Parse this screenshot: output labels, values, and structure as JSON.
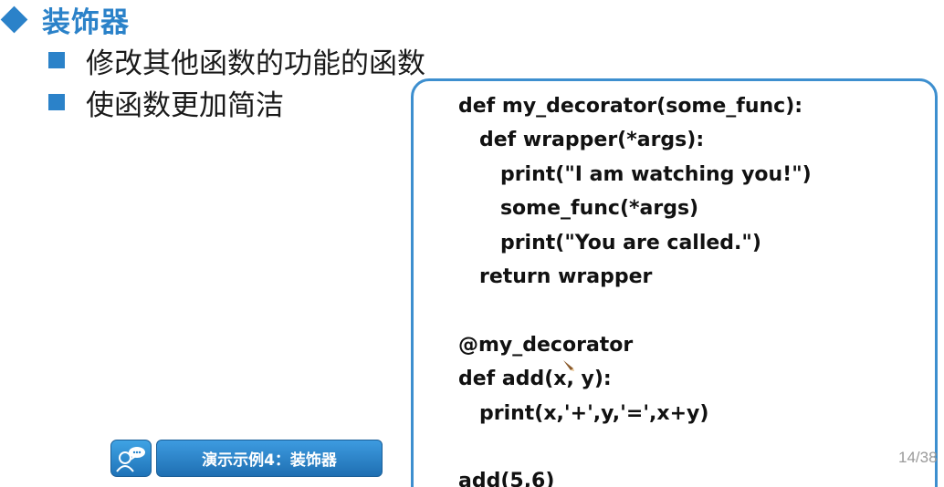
{
  "slide": {
    "title": "装饰器",
    "bullets": [
      {
        "text": "修改其他函数的功能的函数"
      },
      {
        "text": "使函数更加简洁"
      }
    ],
    "code_lines": [
      "def my_decorator(some_func):",
      "   def wrapper(*args):",
      "      print(\"I am watching you!\")",
      "      some_func(*args)",
      "      print(\"You are called.\")",
      "   return wrapper",
      "",
      "@my_decorator",
      "def add(x, y):",
      "   print(x,'+',y,'=',x+y)",
      "",
      "add(5,6)"
    ],
    "demo_button_label": "演示示例4：装饰器",
    "demo_icon": "chat-person-icon",
    "page_number": "14/38"
  },
  "colors": {
    "accent": "#2b82c9",
    "code_border": "#3d8fcf",
    "button_fill": "#2a86cc",
    "page_number": "#9a9a9a"
  }
}
